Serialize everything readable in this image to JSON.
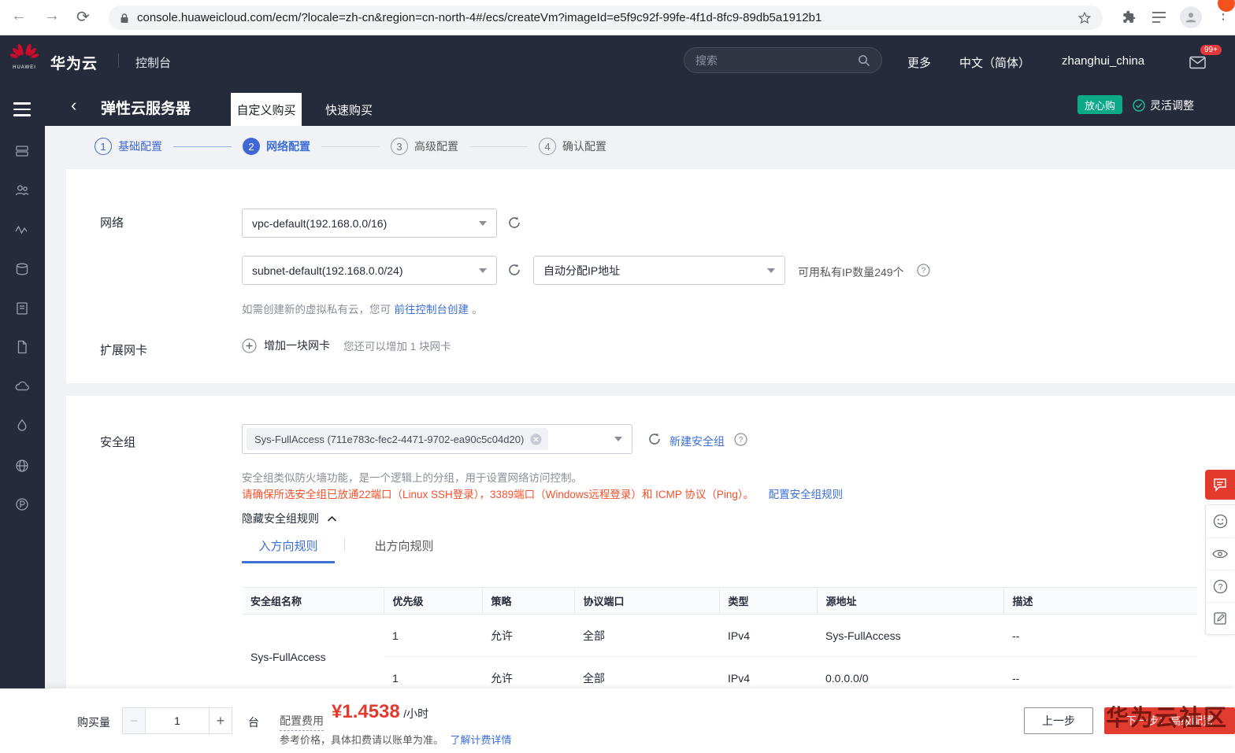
{
  "browser": {
    "url": "console.huaweicloud.com/ecm/?locale=zh-cn&region=cn-north-4#/ecs/createVm?imageId=e5f9c92f-99fe-4f1d-8fc9-89db5a1912b1"
  },
  "top_nav": {
    "brand": "华为云",
    "console_link": "控制台",
    "search_placeholder": "搜索",
    "more": "更多",
    "language": "中文（简体）",
    "username": "zhanghui_china",
    "mail_badge": "99+"
  },
  "page_header": {
    "title": "弹性云服务器",
    "tab_custom": "自定义购买",
    "tab_quick": "快速购买",
    "badge_assurance": "放心购",
    "badge_flexible": "灵活调整"
  },
  "steps": [
    {
      "num": "1",
      "label": "基础配置",
      "state": "done"
    },
    {
      "num": "2",
      "label": "网络配置",
      "state": "active"
    },
    {
      "num": "3",
      "label": "高级配置",
      "state": "pending"
    },
    {
      "num": "4",
      "label": "确认配置",
      "state": "pending"
    }
  ],
  "network": {
    "label": "网络",
    "vpc_value": "vpc-default(192.168.0.0/16)",
    "subnet_value": "subnet-default(192.168.0.0/24)",
    "ip_mode_value": "自动分配IP地址",
    "ip_available": "可用私有IP数量249个",
    "hint_prefix": "如需创建新的虚拟私有云，您可",
    "hint_link": "前往控制台创建",
    "hint_suffix": "。",
    "nic_label": "扩展网卡",
    "add_nic": "增加一块网卡",
    "nic_hint": "您还可以增加 1 块网卡"
  },
  "security": {
    "label": "安全组",
    "sg_tag": "Sys-FullAccess (711e783c-fec2-4471-9702-ea90c5c04d20)",
    "new_sg_link": "新建安全组",
    "desc": "安全组类似防火墙功能，是一个逻辑上的分组，用于设置网络访问控制。",
    "warning": "请确保所选安全组已放通22端口（Linux SSH登录），3389端口（Windows远程登录）和 ICMP 协议（Ping）。",
    "config_rule_link": "配置安全组规则",
    "hide_rules": "隐藏安全组规则",
    "tab_in": "入方向规则",
    "tab_out": "出方向规则",
    "table": {
      "headers": [
        "安全组名称",
        "优先级",
        "策略",
        "协议端口",
        "类型",
        "源地址",
        "描述"
      ],
      "group_name": "Sys-FullAccess",
      "rows": [
        {
          "priority": "1",
          "policy": "允许",
          "protocol": "全部",
          "type": "IPv4",
          "source": "Sys-FullAccess",
          "desc": "--"
        },
        {
          "priority": "1",
          "policy": "允许",
          "protocol": "全部",
          "type": "IPv4",
          "source": "0.0.0.0/0",
          "desc": "--"
        }
      ]
    }
  },
  "footer": {
    "qty_label": "购买量",
    "qty_value": "1",
    "unit": "台",
    "fee_label": "配置费用",
    "price": "¥1.4538",
    "price_unit": "/小时",
    "price_note": "参考价格，具体扣费请以账单为准。",
    "price_link": "了解计费详情",
    "prev_button": "上一步",
    "next_button": "下一步：高级配置",
    "watermark": "华为云社区"
  },
  "colors": {
    "header_bg": "#252b3a",
    "accent_blue": "#3d6fd6",
    "danger_red": "#e43a2e",
    "warning_orange": "#f4502c",
    "teal_badge": "#0aa987",
    "huawei_red": "#cf0a2c"
  },
  "icons": {
    "search-icon": "magnifier",
    "mail-icon": "envelope",
    "refresh-icon": "circular-arrow",
    "help-icon": "question-circle",
    "add-circle-icon": "plus-circle",
    "tag-close-icon": "x-circle",
    "chevron-up-icon": "collapse",
    "feedback-chat-icon": "speech-bubble"
  }
}
